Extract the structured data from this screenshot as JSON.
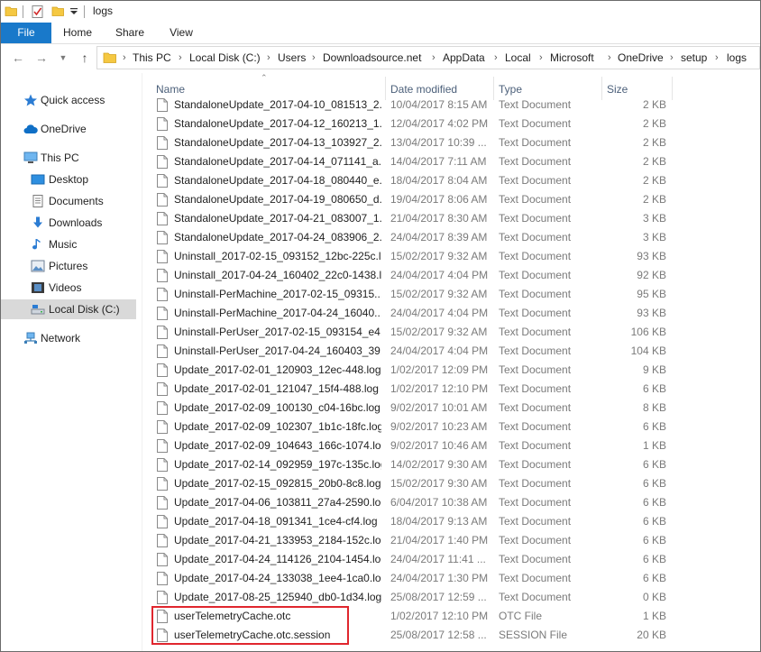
{
  "window": {
    "title": "logs"
  },
  "ribbon": {
    "tabs": [
      "File",
      "Home",
      "Share",
      "View"
    ]
  },
  "address": {
    "crumbs": [
      "This PC",
      "Local Disk (C:)",
      "Users",
      "Downloadsource.net",
      "AppData",
      "Local",
      "Microsoft",
      "OneDrive",
      "setup",
      "logs"
    ]
  },
  "nav": {
    "items": [
      {
        "label": "Quick access",
        "icon": "star-icon"
      },
      {
        "label": "OneDrive",
        "icon": "cloud-icon"
      },
      {
        "label": "This PC",
        "icon": "computer-icon"
      },
      {
        "label": "Desktop",
        "icon": "desktop-icon"
      },
      {
        "label": "Documents",
        "icon": "documents-icon"
      },
      {
        "label": "Downloads",
        "icon": "download-icon"
      },
      {
        "label": "Music",
        "icon": "music-icon"
      },
      {
        "label": "Pictures",
        "icon": "pictures-icon"
      },
      {
        "label": "Videos",
        "icon": "videos-icon"
      },
      {
        "label": "Local Disk (C:)",
        "icon": "drive-icon"
      },
      {
        "label": "Network",
        "icon": "network-icon"
      }
    ]
  },
  "columns": {
    "name": "Name",
    "date": "Date modified",
    "type": "Type",
    "size": "Size"
  },
  "files": [
    {
      "name": "StandaloneUpdate_2017-04-10_081513_2...",
      "date": "10/04/2017 8:15 AM",
      "type": "Text Document",
      "size": "2 KB"
    },
    {
      "name": "StandaloneUpdate_2017-04-12_160213_1...",
      "date": "12/04/2017 4:02 PM",
      "type": "Text Document",
      "size": "2 KB"
    },
    {
      "name": "StandaloneUpdate_2017-04-13_103927_2...",
      "date": "13/04/2017 10:39 ...",
      "type": "Text Document",
      "size": "2 KB"
    },
    {
      "name": "StandaloneUpdate_2017-04-14_071141_a...",
      "date": "14/04/2017 7:11 AM",
      "type": "Text Document",
      "size": "2 KB"
    },
    {
      "name": "StandaloneUpdate_2017-04-18_080440_e...",
      "date": "18/04/2017 8:04 AM",
      "type": "Text Document",
      "size": "2 KB"
    },
    {
      "name": "StandaloneUpdate_2017-04-19_080650_d...",
      "date": "19/04/2017 8:06 AM",
      "type": "Text Document",
      "size": "2 KB"
    },
    {
      "name": "StandaloneUpdate_2017-04-21_083007_1...",
      "date": "21/04/2017 8:30 AM",
      "type": "Text Document",
      "size": "3 KB"
    },
    {
      "name": "StandaloneUpdate_2017-04-24_083906_2...",
      "date": "24/04/2017 8:39 AM",
      "type": "Text Document",
      "size": "3 KB"
    },
    {
      "name": "Uninstall_2017-02-15_093152_12bc-225c.l...",
      "date": "15/02/2017 9:32 AM",
      "type": "Text Document",
      "size": "93 KB"
    },
    {
      "name": "Uninstall_2017-04-24_160402_22c0-1438.l...",
      "date": "24/04/2017 4:04 PM",
      "type": "Text Document",
      "size": "92 KB"
    },
    {
      "name": "Uninstall-PerMachine_2017-02-15_09315...",
      "date": "15/02/2017 9:32 AM",
      "type": "Text Document",
      "size": "95 KB"
    },
    {
      "name": "Uninstall-PerMachine_2017-04-24_16040...",
      "date": "24/04/2017 4:04 PM",
      "type": "Text Document",
      "size": "93 KB"
    },
    {
      "name": "Uninstall-PerUser_2017-02-15_093154_e4...",
      "date": "15/02/2017 9:32 AM",
      "type": "Text Document",
      "size": "106 KB"
    },
    {
      "name": "Uninstall-PerUser_2017-04-24_160403_39...",
      "date": "24/04/2017 4:04 PM",
      "type": "Text Document",
      "size": "104 KB"
    },
    {
      "name": "Update_2017-02-01_120903_12ec-448.log",
      "date": "1/02/2017 12:09 PM",
      "type": "Text Document",
      "size": "9 KB"
    },
    {
      "name": "Update_2017-02-01_121047_15f4-488.log",
      "date": "1/02/2017 12:10 PM",
      "type": "Text Document",
      "size": "6 KB"
    },
    {
      "name": "Update_2017-02-09_100130_c04-16bc.log",
      "date": "9/02/2017 10:01 AM",
      "type": "Text Document",
      "size": "8 KB"
    },
    {
      "name": "Update_2017-02-09_102307_1b1c-18fc.log",
      "date": "9/02/2017 10:23 AM",
      "type": "Text Document",
      "size": "6 KB"
    },
    {
      "name": "Update_2017-02-09_104643_166c-1074.log",
      "date": "9/02/2017 10:46 AM",
      "type": "Text Document",
      "size": "1 KB"
    },
    {
      "name": "Update_2017-02-14_092959_197c-135c.log",
      "date": "14/02/2017 9:30 AM",
      "type": "Text Document",
      "size": "6 KB"
    },
    {
      "name": "Update_2017-02-15_092815_20b0-8c8.log",
      "date": "15/02/2017 9:30 AM",
      "type": "Text Document",
      "size": "6 KB"
    },
    {
      "name": "Update_2017-04-06_103811_27a4-2590.log",
      "date": "6/04/2017 10:38 AM",
      "type": "Text Document",
      "size": "6 KB"
    },
    {
      "name": "Update_2017-04-18_091341_1ce4-cf4.log",
      "date": "18/04/2017 9:13 AM",
      "type": "Text Document",
      "size": "6 KB"
    },
    {
      "name": "Update_2017-04-21_133953_2184-152c.log",
      "date": "21/04/2017 1:40 PM",
      "type": "Text Document",
      "size": "6 KB"
    },
    {
      "name": "Update_2017-04-24_114126_2104-1454.log",
      "date": "24/04/2017 11:41 ...",
      "type": "Text Document",
      "size": "6 KB"
    },
    {
      "name": "Update_2017-04-24_133038_1ee4-1ca0.log",
      "date": "24/04/2017 1:30 PM",
      "type": "Text Document",
      "size": "6 KB"
    },
    {
      "name": "Update_2017-08-25_125940_db0-1d34.log",
      "date": "25/08/2017 12:59 ...",
      "type": "Text Document",
      "size": "0 KB"
    },
    {
      "name": "userTelemetryCache.otc",
      "date": "1/02/2017 12:10 PM",
      "type": "OTC File",
      "size": "1 KB"
    },
    {
      "name": "userTelemetryCache.otc.session",
      "date": "25/08/2017 12:58 ...",
      "type": "SESSION File",
      "size": "20 KB"
    }
  ],
  "colors": {
    "accent": "#1979ca",
    "highlight": "#e0262e",
    "selected_nav": "#d9d9d9"
  }
}
